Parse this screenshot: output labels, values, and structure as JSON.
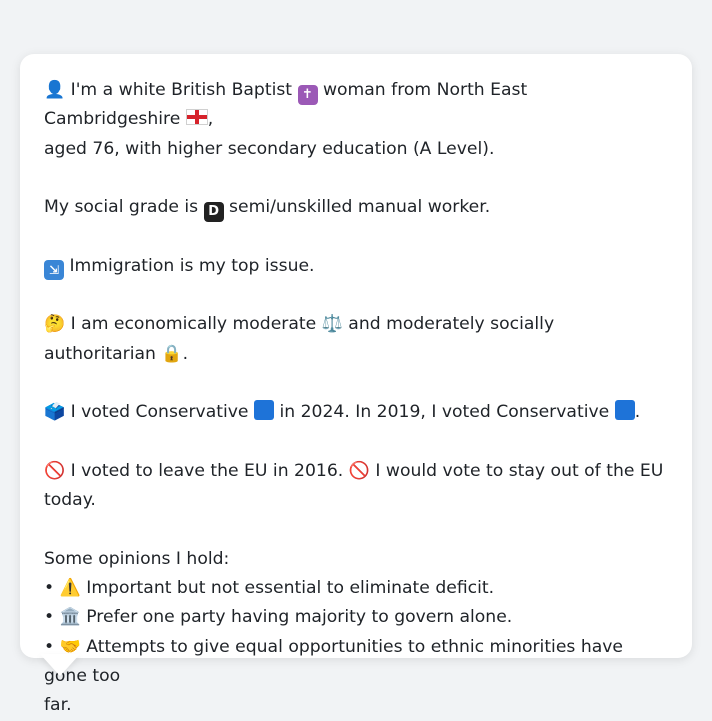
{
  "card": {
    "p1": {
      "icon_person": "👤",
      "text_a": " I'm a white British Baptist ",
      "icon_cross": "✝",
      "text_b": " woman from North East Cambridgeshire ",
      "icon_flag": "england-flag-icon",
      "text_c": ",",
      "text_d": "aged 76, with higher secondary education (A Level)."
    },
    "p2": {
      "text_a": "My social grade is ",
      "icon_grade": "D",
      "text_b": " semi/unskilled manual worker."
    },
    "p3": {
      "icon_baggage": "🛂",
      "text_a": " Immigration is my top issue."
    },
    "p4": {
      "icon_thinking": "🤔",
      "text_a": " I am economically moderate ",
      "icon_scales": "⚖️",
      "text_b": " and moderately socially authoritarian ",
      "icon_lock": "🔒",
      "text_c": "."
    },
    "p5": {
      "icon_ballot": "🗳️",
      "text_a": " I voted Conservative ",
      "text_b": " in 2024. In 2019, I voted Conservative ",
      "text_c": "."
    },
    "p6": {
      "icon_no_a": "🚫",
      "text_a": " I voted to leave the EU in 2016. ",
      "icon_no_b": "🚫",
      "text_b": " I would vote to stay out of the EU",
      "text_c": "today."
    },
    "opinions": {
      "heading": "Some opinions I hold:",
      "bullet": "•",
      "items": [
        {
          "icon": "⚠️",
          "text": " Important but not essential to eliminate deficit."
        },
        {
          "icon": "🏛️",
          "text": " Prefer one party having majority to govern alone."
        },
        {
          "icon": "🤝",
          "text": " Attempts to give equal opportunities to ethnic minorities have gone too",
          "text2": "far."
        }
      ]
    }
  },
  "colors": {
    "background": "#f1f3f5",
    "card": "#ffffff",
    "text": "#1f2328",
    "conservative_blue": "#1e73d8",
    "england_red": "#d6222b"
  }
}
